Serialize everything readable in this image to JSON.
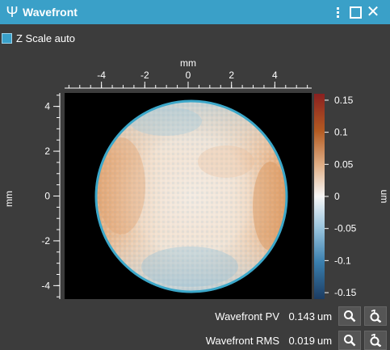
{
  "window": {
    "title": "Wavefront"
  },
  "options": {
    "z_scale_label": "Z Scale auto",
    "z_scale_checked": true
  },
  "plot": {
    "x_axis_label": "mm",
    "y_axis_label": "mm",
    "x_ticks": [
      "-4",
      "-2",
      "0",
      "2",
      "4"
    ],
    "y_ticks": [
      "4",
      "2",
      "0",
      "-2",
      "-4"
    ],
    "colorbar_unit": "um",
    "colorbar_ticks": [
      "0.15",
      "0.1",
      "0.05",
      "0",
      "-0.05",
      "-0.1",
      "-0.15"
    ],
    "x_range": [
      -5.7,
      5.7
    ],
    "y_range": [
      -4.6,
      4.6
    ],
    "z_range": [
      -0.16,
      0.16
    ],
    "colors": {
      "pupil_ring": "#3ba7c9",
      "positive": "#b35a22",
      "negative": "#2f6f99",
      "background": "#000000"
    }
  },
  "stats": [
    {
      "name": "Wavefront PV",
      "value": "0.143",
      "unit": "um"
    },
    {
      "name": "Wavefront RMS",
      "value": "0.019",
      "unit": "um"
    }
  ],
  "icons": {
    "zoom": "zoom-icon",
    "zoom_reset": "zoom-reset-icon",
    "menu": "more-vertical-icon",
    "maximize": "maximize-icon",
    "close": "close-icon",
    "app": "psi-icon"
  }
}
